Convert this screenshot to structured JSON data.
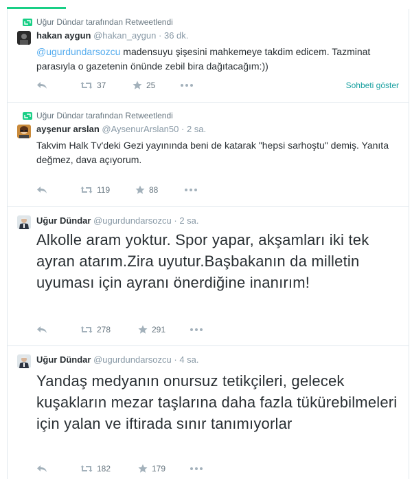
{
  "tweets": [
    {
      "retweeted_by": "Uğur Dündar tarafından Retweetlendi",
      "fullname": "hakan aygun",
      "username": "@hakan_aygun",
      "time": "36 dk.",
      "mention": "@ugurdundarsozcu",
      "text": " madensuyu şişesini mahkemeye takdim edicem. Tazminat parasıyla o gazetenin önünde zebil bira dağıtacağım:))",
      "retweets": "37",
      "favorites": "25",
      "conversation": "Sohbeti göster"
    },
    {
      "retweeted_by": "Uğur Dündar tarafından Retweetlendi",
      "fullname": "ayşenur arslan",
      "username": "@AysenurArslan50",
      "time": "2 sa.",
      "text": "Takvim Halk Tv'deki Gezi yayınında beni de katarak \"hepsi sarhoştu\" demiş. Yanıta değmez, dava açıyorum.",
      "retweets": "119",
      "favorites": "88"
    },
    {
      "fullname": "Uğur Dündar",
      "username": "@ugurdundarsozcu",
      "time": "2 sa.",
      "text": "Alkolle aram yoktur. Spor yapar, akşamları iki tek ayran atarım.Zira uyutur.Başbakanın da  milletin uyuması için ayranı önerdiğine inanırım!",
      "retweets": "278",
      "favorites": "291"
    },
    {
      "fullname": "Uğur Dündar",
      "username": "@ugurdundarsozcu",
      "time": "4 sa.",
      "text": "Yandaş medyanın onursuz tetikçileri, gelecek kuşakların mezar taşlarına daha fazla tükürebilmeleri için yalan ve iftirada sınır tanımıyorlar",
      "retweets": "182",
      "favorites": "179"
    }
  ],
  "colors": {
    "accent": "#19cf86",
    "link": "#55acee",
    "muted": "#8899a6",
    "retweet_green": "#19cf86"
  }
}
